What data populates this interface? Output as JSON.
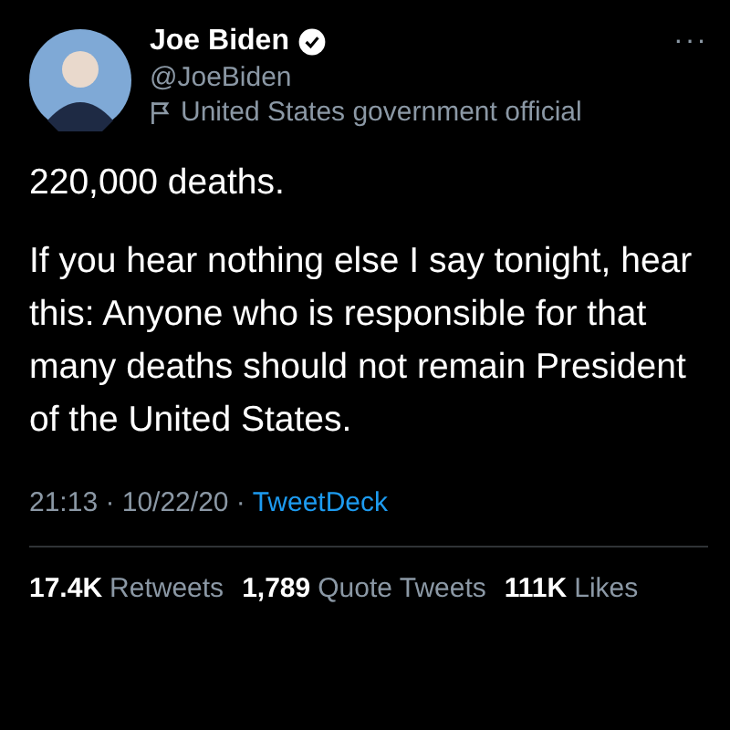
{
  "author": {
    "name": "Joe Biden",
    "verified": true,
    "handle": "@JoeBiden",
    "label": "United States government official"
  },
  "more": "···",
  "paragraphs": [
    "220,000 deaths.",
    "If you hear nothing else I say tonight, hear this: Anyone who is responsible for that many deaths should not remain President of the United States."
  ],
  "meta": {
    "time": "21:13 · 10/22/20 · ",
    "source": "TweetDeck"
  },
  "stats": [
    {
      "count": "17.4K",
      "label": "Retweets"
    },
    {
      "count": "1,789",
      "label": "Quote Tweets"
    },
    {
      "count": "111K",
      "label": "Likes"
    }
  ]
}
